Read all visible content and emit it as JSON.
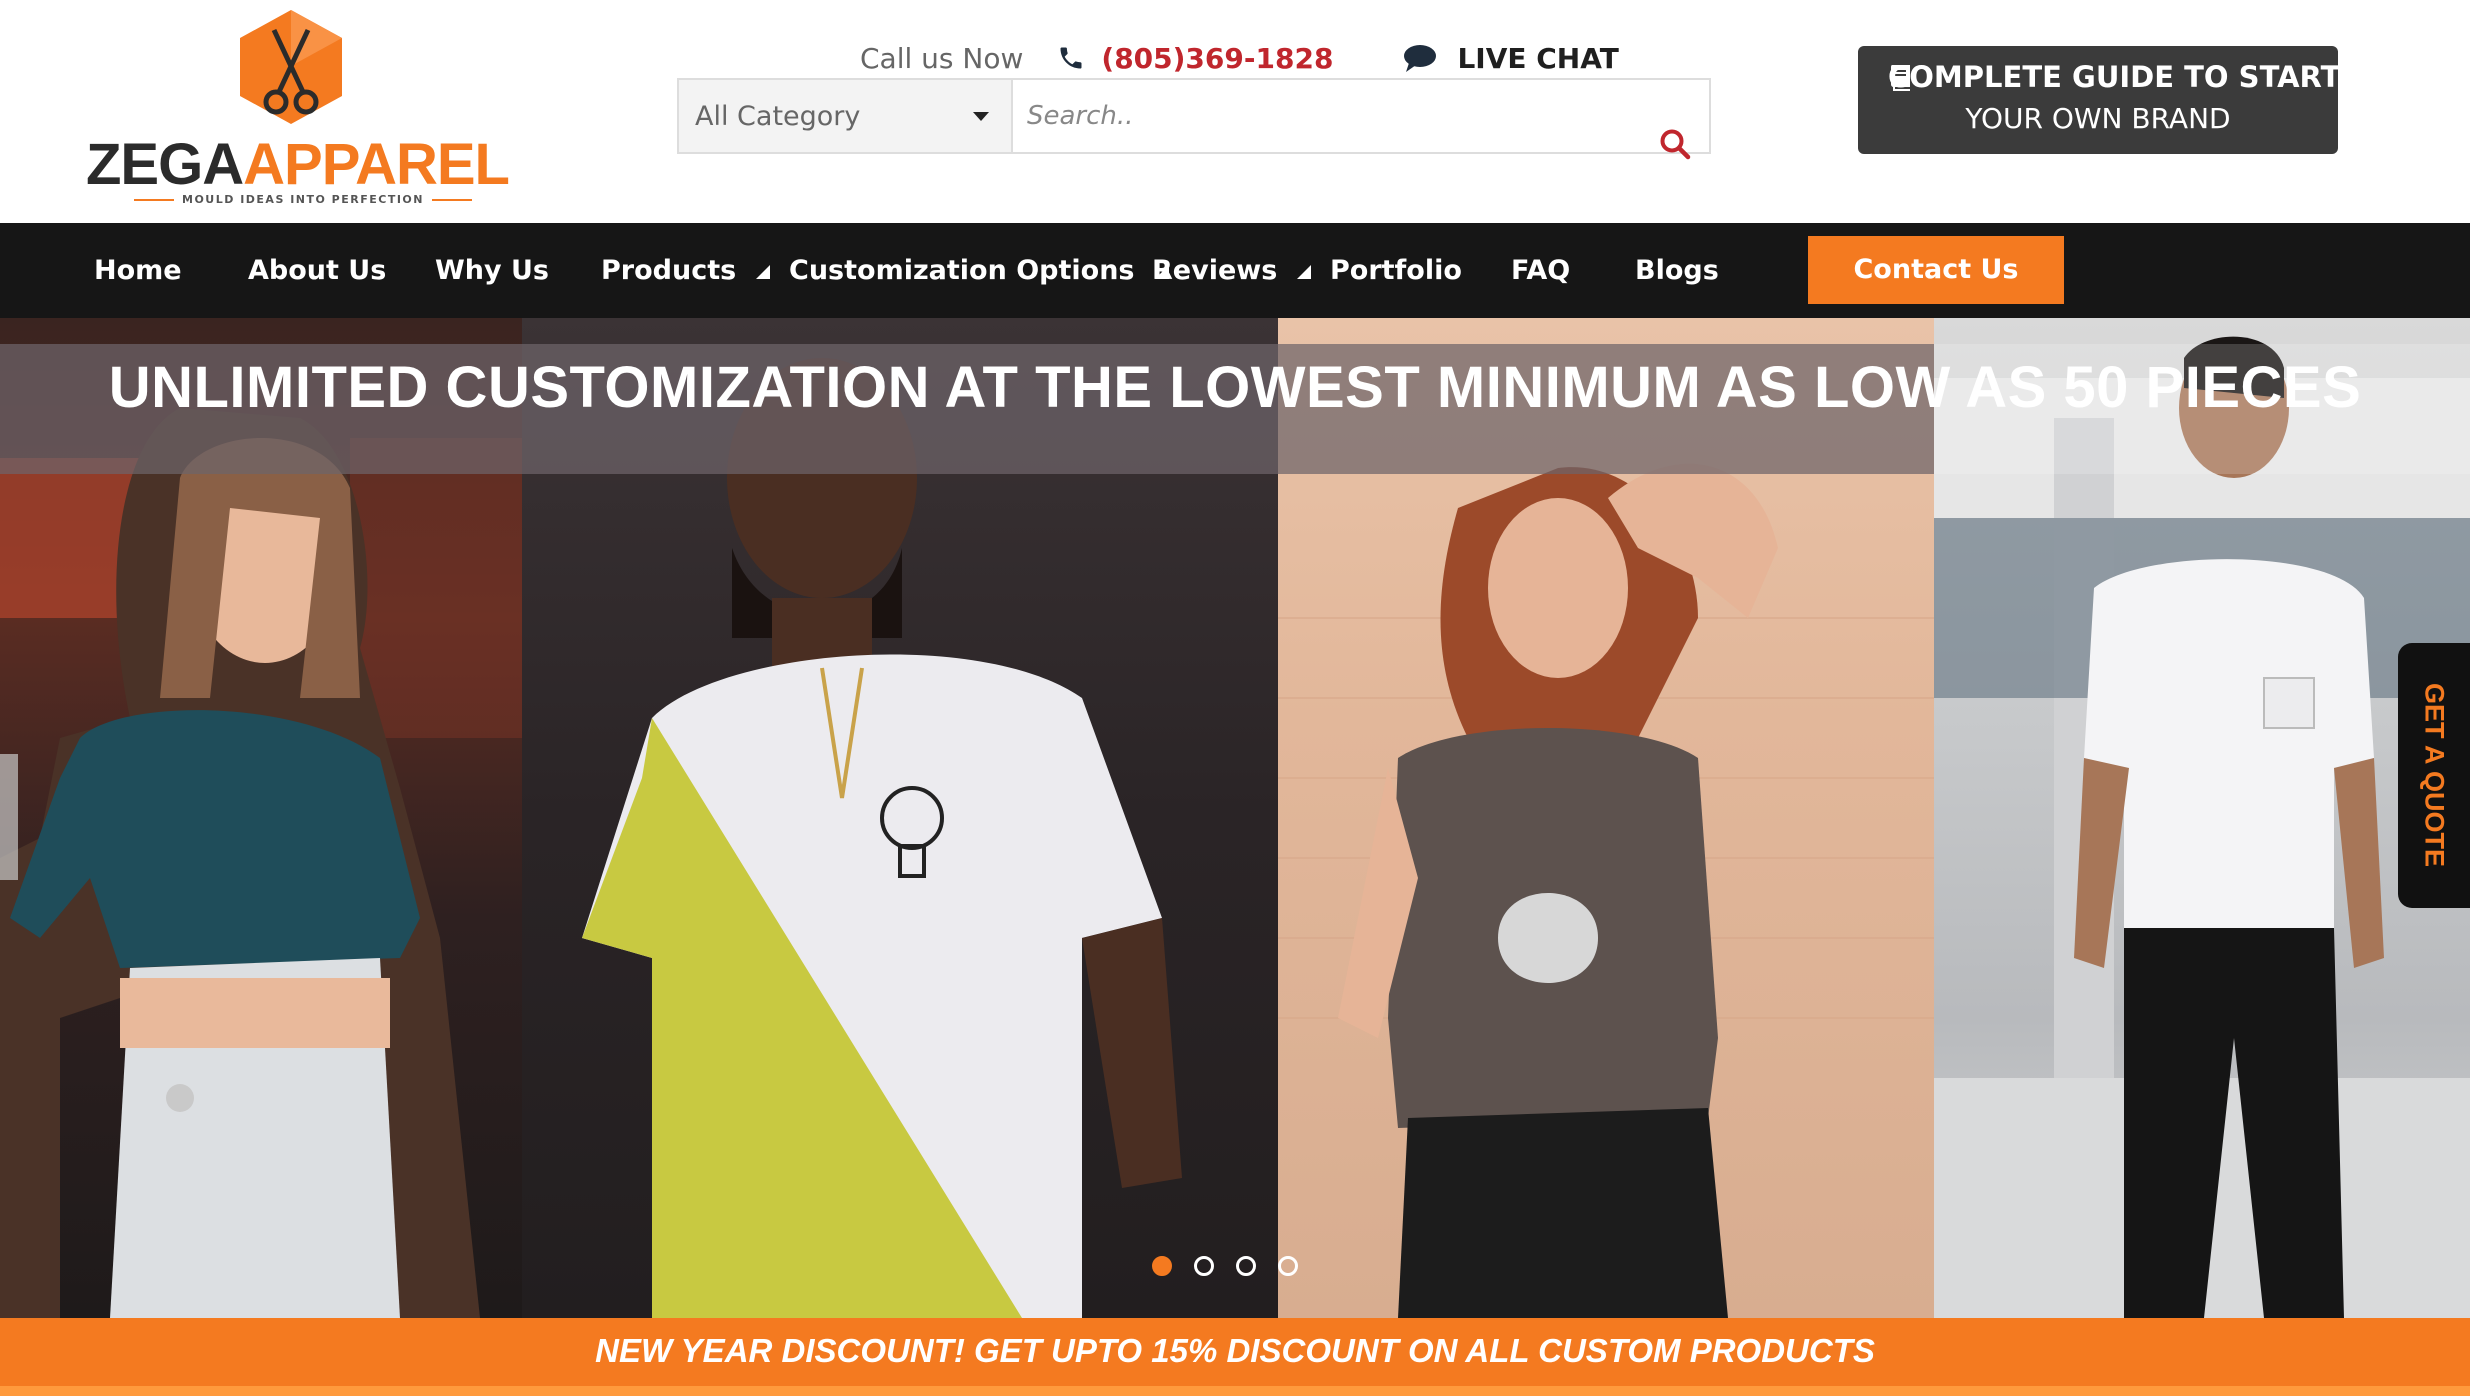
{
  "logo": {
    "brand_part1": "ZEGA",
    "brand_part2": "APPAREL",
    "tagline": "MOULD IDEAS INTO PERFECTION",
    "icon": "scissors-hexagon-icon"
  },
  "header": {
    "call_label": "Call us Now",
    "phone_icon": "phone-icon",
    "phone_number": "(805)369-1828",
    "chat_icon": "chat-bubble-icon",
    "chat_label": "LIVE CHAT",
    "category_selected": "All Category",
    "search_placeholder": "Search..",
    "search_icon": "search-icon",
    "guide_line1": "COMPLETE GUIDE TO START",
    "guide_line2": "YOUR OWN BRAND",
    "guide_icon": "book-icon"
  },
  "nav": {
    "items": [
      {
        "label": "Home"
      },
      {
        "label": "About Us"
      },
      {
        "label": "Why Us"
      },
      {
        "label": "Products"
      },
      {
        "label": "Customization Options"
      },
      {
        "label": "Reviews"
      },
      {
        "label": "Portfolio"
      },
      {
        "label": "FAQ"
      },
      {
        "label": "Blogs"
      }
    ],
    "contact_label": "Contact Us"
  },
  "hero": {
    "headline": "UNLIMITED CUSTOMIZATION AT THE LOWEST MINIMUM AS LOW AS 50 PIECES",
    "slides_total": 4,
    "active_slide": 1,
    "quote_tab": "GET A QUOTE"
  },
  "promo": {
    "text": "NEW YEAR DISCOUNT! GET UPTO 15% DISCOUNT ON ALL CUSTOM PRODUCTS"
  },
  "colors": {
    "accent": "#f47a20",
    "nav_bg": "#161616",
    "phone": "#c0262d",
    "guide_bg": "#3b3b3b"
  }
}
